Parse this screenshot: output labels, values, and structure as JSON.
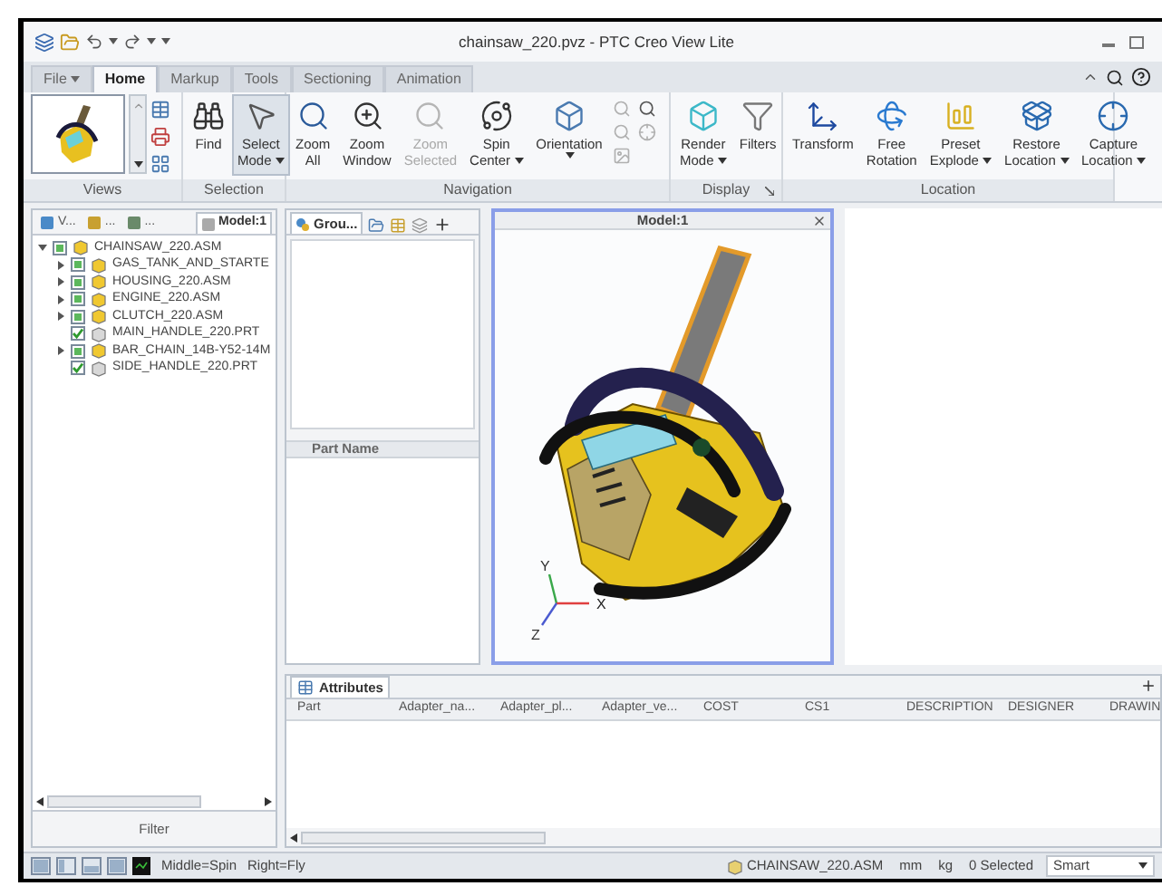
{
  "window": {
    "title": "chainsaw_220.pvz - PTC Creo View Lite"
  },
  "menu_tabs": [
    {
      "label": "File",
      "selected": false,
      "dropdown": true
    },
    {
      "label": "Home",
      "selected": true,
      "dropdown": false
    },
    {
      "label": "Markup",
      "selected": false,
      "dropdown": false
    },
    {
      "label": "Tools",
      "selected": false,
      "dropdown": false
    },
    {
      "label": "Sectioning",
      "selected": false,
      "dropdown": false
    },
    {
      "label": "Animation",
      "selected": false,
      "dropdown": false
    }
  ],
  "ribbon": [
    {
      "label": "Views",
      "kind": "views"
    },
    {
      "label": "Selection",
      "kind": "buttons",
      "buttons": [
        {
          "lines": [
            "Find"
          ],
          "dropdown": false,
          "selected": false,
          "disabled": false
        },
        {
          "lines": [
            "Select",
            "Mode"
          ],
          "dropdown": true,
          "selected": true,
          "disabled": false
        }
      ]
    },
    {
      "label": "Navigation",
      "kind": "buttons",
      "buttons": [
        {
          "lines": [
            "Zoom",
            "All"
          ],
          "dropdown": false,
          "selected": false,
          "disabled": false
        },
        {
          "lines": [
            "Zoom",
            "Window"
          ],
          "dropdown": false,
          "selected": false,
          "disabled": false
        },
        {
          "lines": [
            "Zoom",
            "Selected"
          ],
          "dropdown": false,
          "selected": false,
          "disabled": true
        },
        {
          "lines": [
            "Spin",
            "Center"
          ],
          "dropdown": true,
          "selected": false,
          "disabled": false
        },
        {
          "lines": [
            "Orientation"
          ],
          "dropdown": true,
          "selected": false,
          "disabled": false
        }
      ]
    },
    {
      "label": "Display",
      "kind": "buttons",
      "launcher": true,
      "buttons": [
        {
          "lines": [
            "Render",
            "Mode"
          ],
          "dropdown": true,
          "selected": false,
          "disabled": false
        },
        {
          "lines": [
            "Filters"
          ],
          "dropdown": false,
          "selected": false,
          "disabled": false
        }
      ]
    },
    {
      "label": "Location",
      "kind": "buttons",
      "buttons": [
        {
          "lines": [
            "Transform"
          ],
          "dropdown": false,
          "selected": false,
          "disabled": false
        },
        {
          "lines": [
            "Free",
            "Rotation"
          ],
          "dropdown": false,
          "selected": false,
          "disabled": false
        },
        {
          "lines": [
            "Preset",
            "Explode"
          ],
          "dropdown": true,
          "selected": false,
          "disabled": false
        },
        {
          "lines": [
            "Restore",
            "Location"
          ],
          "dropdown": true,
          "selected": false,
          "disabled": false
        },
        {
          "lines": [
            "Capture",
            "Location"
          ],
          "dropdown": true,
          "selected": false,
          "disabled": false
        }
      ]
    }
  ],
  "model_tree": {
    "tabs": [
      {
        "label": "V...",
        "selected": false
      },
      {
        "label": "...",
        "selected": false
      },
      {
        "label": "...",
        "selected": false
      },
      {
        "label": "Model:1",
        "selected": true
      }
    ],
    "items": [
      {
        "label": "CHAINSAW_220.ASM",
        "kind": "assembly",
        "checked": true,
        "partial": true,
        "expanded": true,
        "children": [
          {
            "label": "GAS_TANK_AND_STARTE",
            "kind": "assembly",
            "checked": true,
            "partial": true,
            "expanded": false
          },
          {
            "label": "HOUSING_220.ASM",
            "kind": "assembly",
            "checked": true,
            "partial": true,
            "expanded": false
          },
          {
            "label": "ENGINE_220.ASM",
            "kind": "assembly",
            "checked": true,
            "partial": true,
            "expanded": false
          },
          {
            "label": "CLUTCH_220.ASM",
            "kind": "assembly",
            "checked": true,
            "partial": true,
            "expanded": false
          },
          {
            "label": "MAIN_HANDLE_220.PRT",
            "kind": "part",
            "checked": true,
            "partial": false
          },
          {
            "label": "BAR_CHAIN_14B-Y52-14M",
            "kind": "assembly",
            "checked": true,
            "partial": true,
            "expanded": false
          },
          {
            "label": "SIDE_HANDLE_220.PRT",
            "kind": "part",
            "checked": true,
            "partial": false
          }
        ]
      }
    ],
    "filter": "Filter"
  },
  "group_panel": {
    "tab": "Grou...",
    "part_list_header": "Part Name"
  },
  "viewport": {
    "title": "Model:1",
    "axes": {
      "x": "X",
      "y": "Y",
      "z": "Z"
    }
  },
  "attributes": {
    "tab": "Attributes",
    "columns": [
      "Part",
      "Adapter_na...",
      "Adapter_pl...",
      "Adapter_ve...",
      "COST",
      "CS1",
      "DESCRIPTION",
      "DESIGNER",
      "DRAWIN"
    ]
  },
  "status_bar": {
    "hint_1": "Middle=Spin",
    "hint_2": "Right=Fly",
    "model": "CHAINSAW_220.ASM",
    "length_unit": "mm",
    "mass_unit": "kg",
    "selection": "0 Selected",
    "filter_mode": "Smart"
  }
}
